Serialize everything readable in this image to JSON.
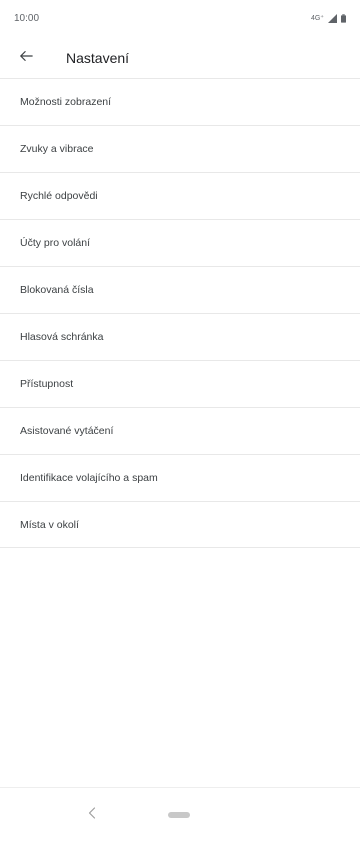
{
  "status_bar": {
    "time": "10:00",
    "network": "4G⁺"
  },
  "app_bar": {
    "title": "Nastavení"
  },
  "settings": {
    "items": [
      {
        "label": "Možnosti zobrazení"
      },
      {
        "label": "Zvuky a vibrace"
      },
      {
        "label": "Rychlé odpovědi"
      },
      {
        "label": "Účty pro volání"
      },
      {
        "label": "Blokovaná čísla"
      },
      {
        "label": "Hlasová schránka"
      },
      {
        "label": "Přístupnost"
      },
      {
        "label": "Asistované vytáčení"
      },
      {
        "label": "Identifikace volajícího a spam"
      },
      {
        "label": "Místa v okolí"
      }
    ]
  },
  "icons": {
    "back": "arrow-left-icon",
    "signal": "signal-icon",
    "battery": "battery-icon",
    "nav_back": "chevron-left-icon",
    "nav_home": "home-pill-icon"
  },
  "colors": {
    "background": "#ffffff",
    "divider": "#e8e8e8",
    "text_primary": "#202124",
    "text_secondary": "#5f6368"
  }
}
